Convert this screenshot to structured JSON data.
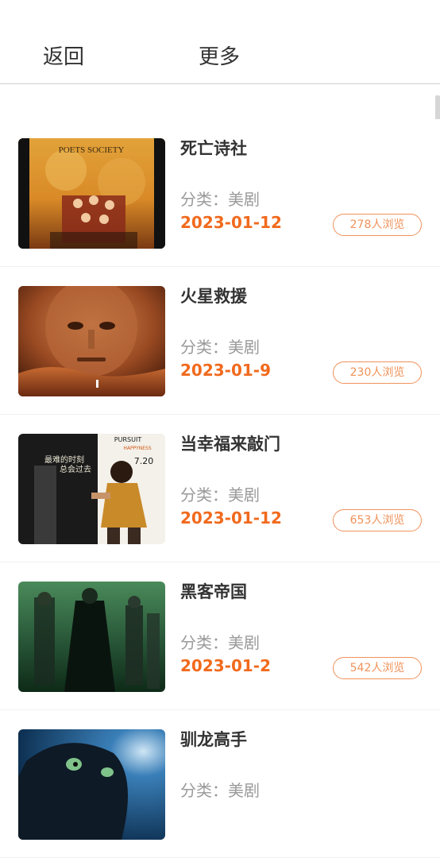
{
  "header": {
    "back_label": "返回",
    "more_label": "更多"
  },
  "items": [
    {
      "title": "死亡诗社",
      "category": "分类：美剧",
      "date": "2023-01-12",
      "views": "278人浏览",
      "thumb_icon": "poster-dead-poets-society",
      "poster_text": "POETS SOCIETY"
    },
    {
      "title": "火星救援",
      "category": "分类：美剧",
      "date": "2023-01-9",
      "views": "230人浏览",
      "thumb_icon": "poster-the-martian"
    },
    {
      "title": "当幸福来敲门",
      "category": "分类：美剧",
      "date": "2023-01-12",
      "views": "653人浏览",
      "thumb_icon": "poster-pursuit-of-happyness",
      "poster_text_a": "最难的时刻",
      "poster_text_b": "总会过去",
      "poster_text_c": "7.20",
      "poster_text_d": "PURSUIT",
      "poster_text_e": "HAPPYNESS"
    },
    {
      "title": "黑客帝国",
      "category": "分类：美剧",
      "date": "2023-01-2",
      "views": "542人浏览",
      "thumb_icon": "poster-the-matrix"
    },
    {
      "title": "驯龙高手",
      "category": "分类：美剧",
      "date": "",
      "views": "",
      "thumb_icon": "poster-how-to-train-your-dragon"
    }
  ],
  "colors": {
    "accent": "#f16a1d",
    "badge": "#f0925a",
    "text": "#333333",
    "muted": "#9a9a9a"
  }
}
